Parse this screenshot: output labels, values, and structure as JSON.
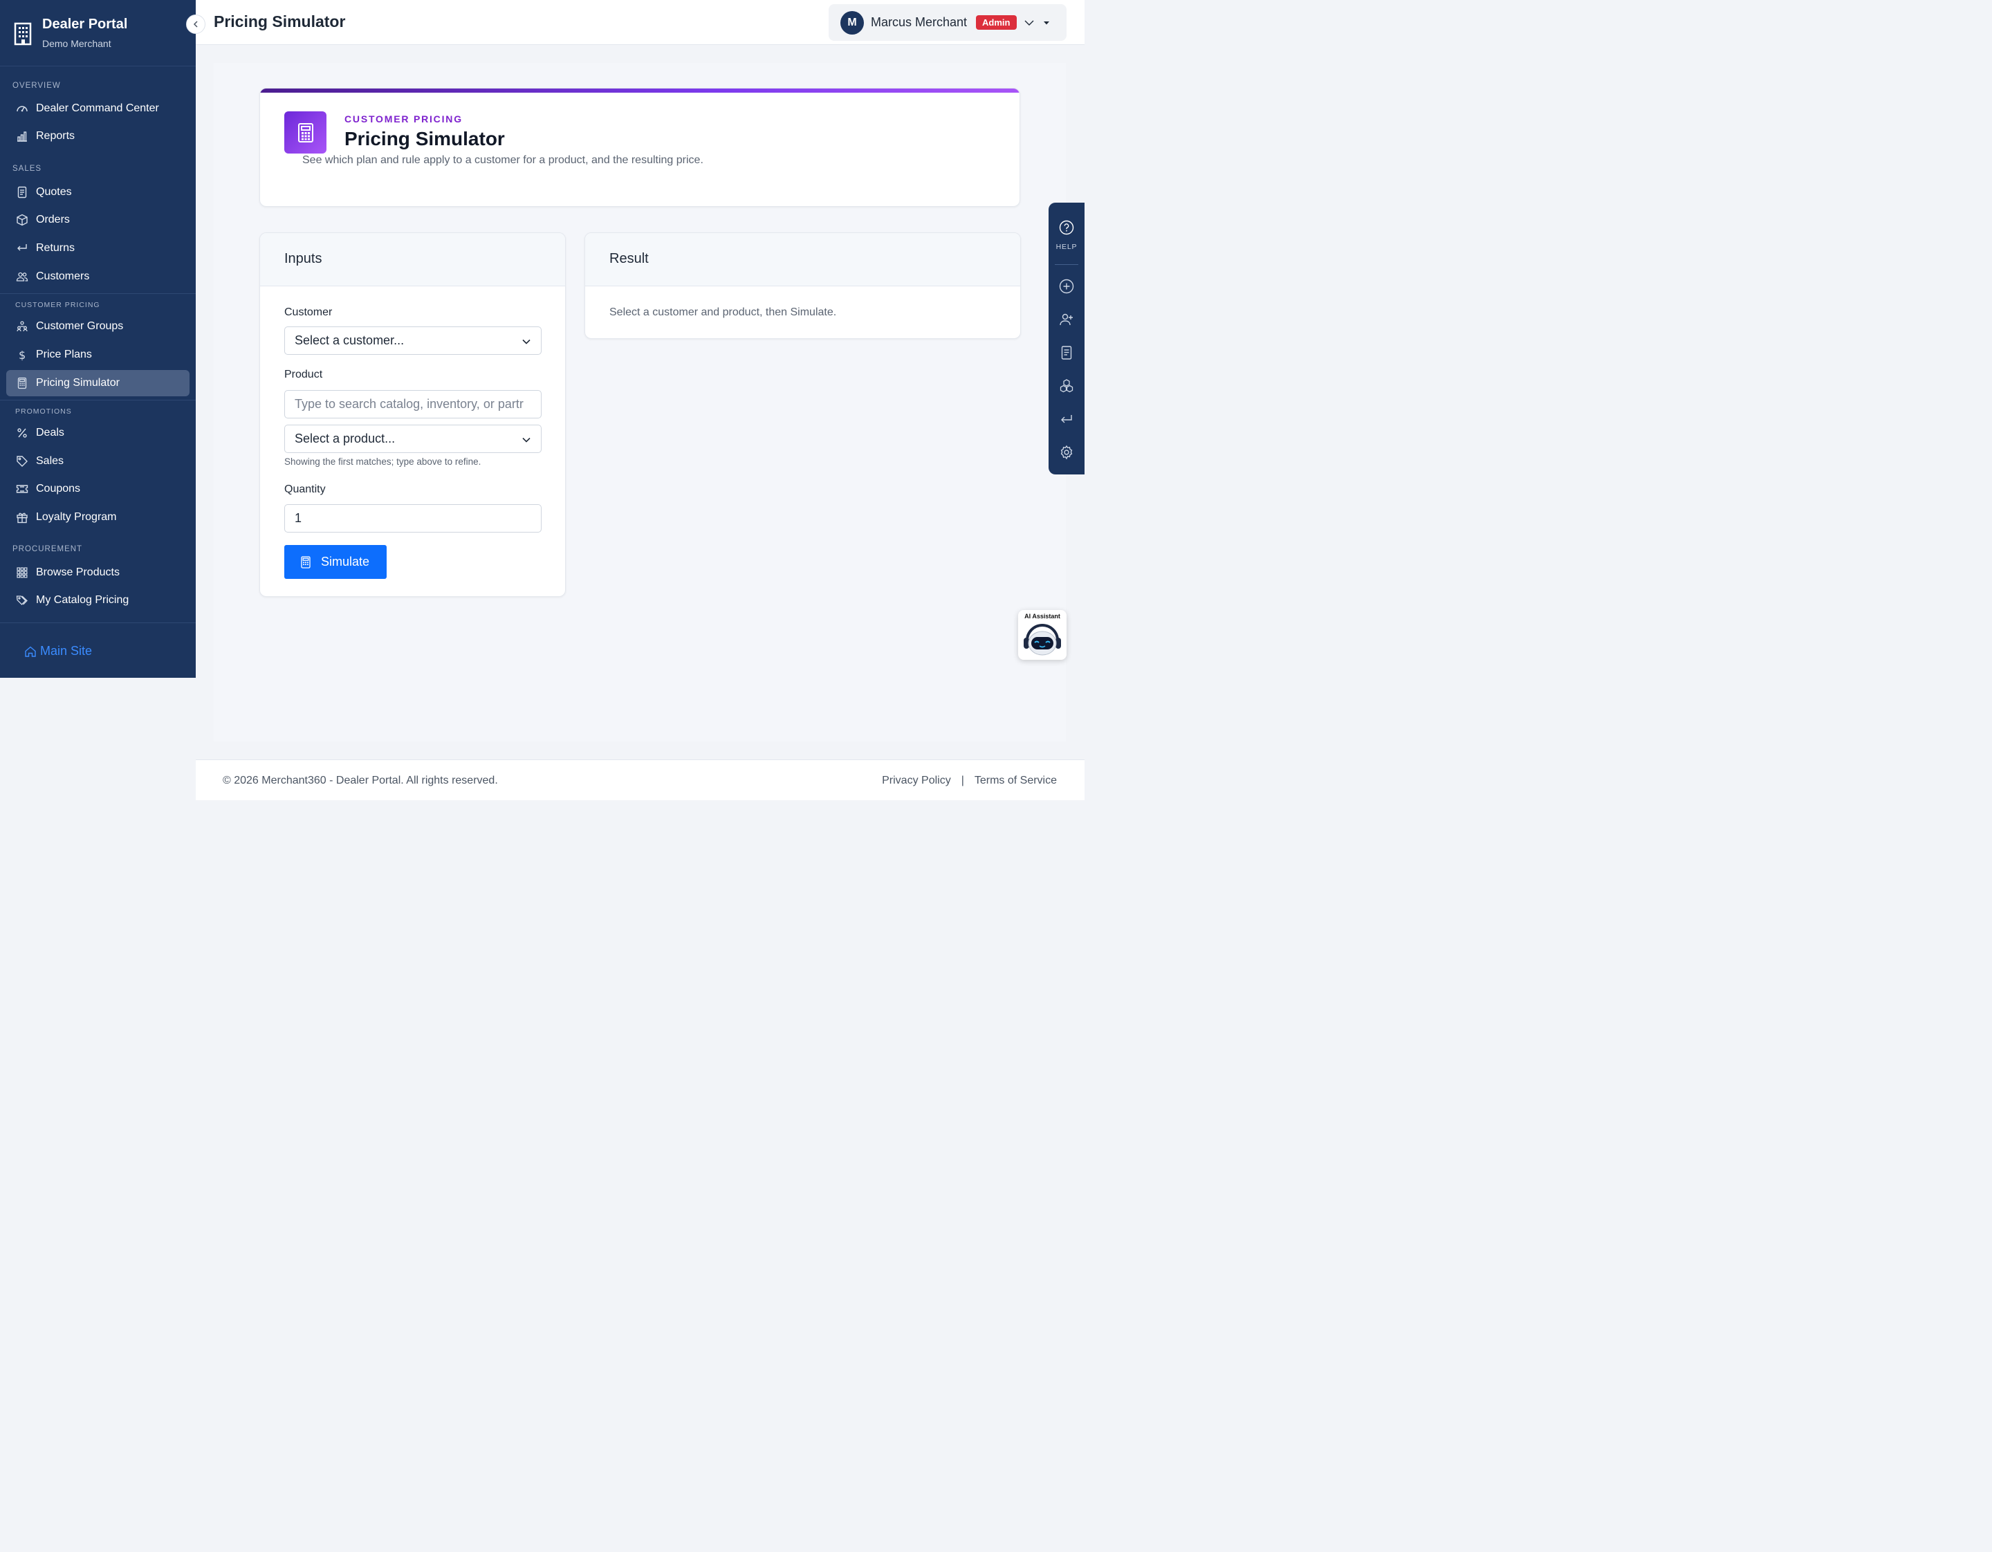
{
  "brand": {
    "title": "Dealer Portal",
    "subtitle": "Demo Merchant"
  },
  "sidebar": {
    "sections": [
      {
        "label": "Overview",
        "items": [
          {
            "label": "Dealer Command Center",
            "icon": "gauge-icon"
          },
          {
            "label": "Reports",
            "icon": "bar-chart-icon"
          }
        ]
      },
      {
        "label": "Sales",
        "items": [
          {
            "label": "Quotes",
            "icon": "document-icon"
          },
          {
            "label": "Orders",
            "icon": "box-icon"
          },
          {
            "label": "Returns",
            "icon": "return-arrow-icon"
          },
          {
            "label": "Customers",
            "icon": "people-icon"
          }
        ]
      },
      {
        "label": "Customer Pricing",
        "items": [
          {
            "label": "Customer Groups",
            "icon": "group-icon"
          },
          {
            "label": "Price Plans",
            "icon": "dollar-icon"
          },
          {
            "label": "Pricing Simulator",
            "icon": "calculator-icon",
            "active": true
          }
        ]
      },
      {
        "label": "Promotions",
        "items": [
          {
            "label": "Deals",
            "icon": "percent-icon"
          },
          {
            "label": "Sales",
            "icon": "tag-icon"
          },
          {
            "label": "Coupons",
            "icon": "ticket-icon"
          },
          {
            "label": "Loyalty Program",
            "icon": "gift-icon"
          }
        ]
      },
      {
        "label": "Procurement",
        "items": [
          {
            "label": "Browse Products",
            "icon": "grid-icon"
          },
          {
            "label": "My Catalog Pricing",
            "icon": "tags-icon"
          }
        ]
      }
    ],
    "footer_link": "Main Site"
  },
  "header": {
    "title": "Pricing Simulator",
    "user": {
      "initial": "M",
      "name": "Marcus Merchant",
      "role": "Admin"
    }
  },
  "hero": {
    "eyebrow": "CUSTOMER PRICING",
    "title": "Pricing Simulator",
    "description": "See which plan and rule apply to a customer for a product, and the resulting price."
  },
  "inputs": {
    "heading": "Inputs",
    "customer_label": "Customer",
    "customer_value": "Select a customer...",
    "product_label": "Product",
    "product_search_placeholder": "Type to search catalog, inventory, or partr",
    "product_value": "Select a product...",
    "product_hint": "Showing the first matches; type above to refine.",
    "quantity_label": "Quantity",
    "quantity_value": "1",
    "simulate_label": "Simulate"
  },
  "result": {
    "heading": "Result",
    "empty_text": "Select a customer and product, then Simulate."
  },
  "help_rail": {
    "help_label": "HELP"
  },
  "ai_assistant": {
    "label": "AI Assistant"
  },
  "footer": {
    "copyright": "© 2026 Merchant360 - Dealer Portal. All rights reserved.",
    "privacy": "Privacy Policy",
    "terms": "Terms of Service"
  },
  "colors": {
    "sidebar": "#1c355e",
    "primary": "#0d6efd",
    "accent": "#7e22ce",
    "badge": "#dc2f3c"
  }
}
